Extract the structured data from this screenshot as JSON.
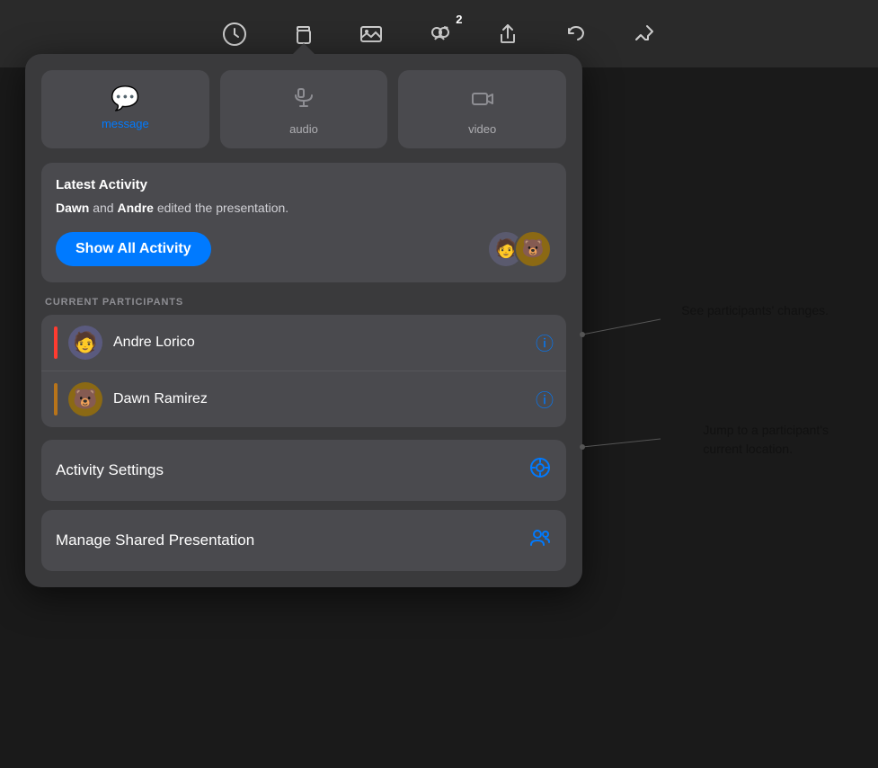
{
  "toolbar": {
    "icons": [
      {
        "name": "clock-icon",
        "symbol": "🕐",
        "label": "History"
      },
      {
        "name": "copy-icon",
        "symbol": "⊞",
        "label": "Copy"
      },
      {
        "name": "photo-icon",
        "symbol": "🖼",
        "label": "Media"
      },
      {
        "name": "collab-icon",
        "symbol": "✅",
        "label": "Collaboration",
        "badge": "2"
      },
      {
        "name": "share-icon",
        "symbol": "⬆",
        "label": "Share"
      },
      {
        "name": "undo-icon",
        "symbol": "↩",
        "label": "Undo"
      },
      {
        "name": "pin-icon",
        "symbol": "📌",
        "label": "Pin"
      }
    ]
  },
  "popup": {
    "comm_buttons": [
      {
        "id": "message",
        "icon": "💬",
        "label": "message",
        "active": true
      },
      {
        "id": "audio",
        "icon": "📞",
        "label": "audio",
        "active": false
      },
      {
        "id": "video",
        "icon": "🎥",
        "label": "video",
        "active": false
      }
    ],
    "latest_activity": {
      "title": "Latest Activity",
      "description_prefix": "",
      "person1": "Dawn",
      "conjunction": " and ",
      "person2": "Andre",
      "description_suffix": " edited the presentation.",
      "show_all_button": "Show All Activity",
      "avatars": [
        "🧑",
        "🐻"
      ]
    },
    "participants_section": {
      "label": "CURRENT PARTICIPANTS",
      "participants": [
        {
          "name": "Andre Lorico",
          "avatar": "🧑",
          "color": "#FF3B30"
        },
        {
          "name": "Dawn Ramirez",
          "avatar": "🐻",
          "color": "#B8741A"
        }
      ]
    },
    "action_rows": [
      {
        "label": "Activity Settings",
        "icon": "⚙️",
        "icon_color": "#007AFF"
      },
      {
        "label": "Manage Shared Presentation",
        "icon": "👥",
        "icon_color": "#007AFF"
      }
    ]
  },
  "callouts": [
    {
      "id": "callout-1",
      "text": "See participants'\nchanges."
    },
    {
      "id": "callout-2",
      "text": "Jump to a participant's\ncurrent location."
    }
  ]
}
